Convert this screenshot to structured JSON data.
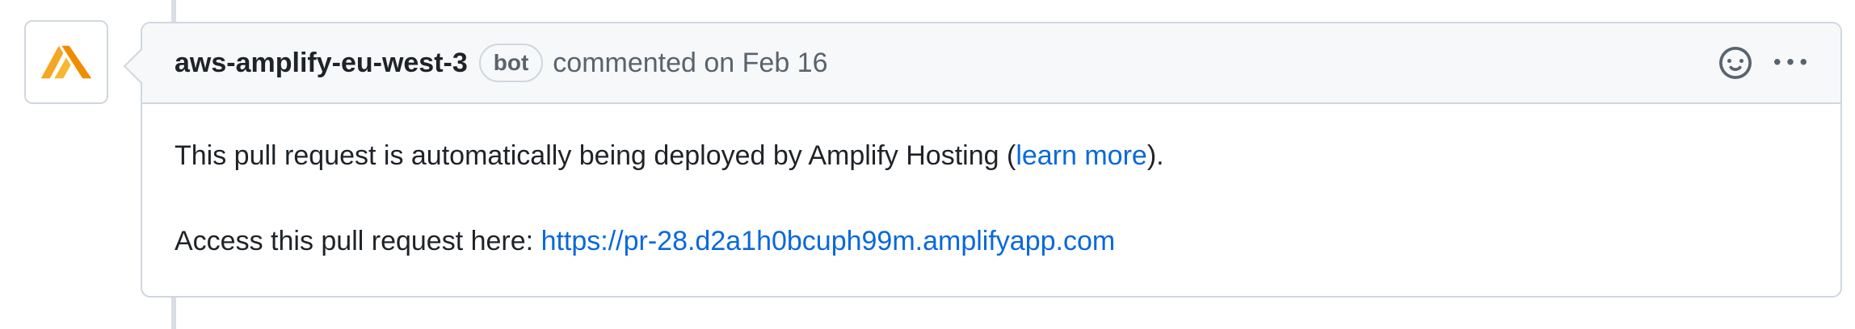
{
  "comment": {
    "author": "aws-amplify-eu-west-3",
    "badge": "bot",
    "meta": "commented on Feb 16",
    "body": {
      "line1_prefix": "This pull request is automatically being deployed by Amplify Hosting (",
      "line1_link": "learn more",
      "line1_suffix": ").",
      "line2_prefix": "Access this pull request here: ",
      "line2_link": "https://pr-28.d2a1h0bcuph99m.amplifyapp.com"
    }
  },
  "icons": {
    "avatar": "aws-amplify-logo",
    "reaction": "smiley-icon",
    "more": "kebab-horizontal-icon"
  },
  "colors": {
    "link": "#0969da",
    "header_bg": "#f6f8fa",
    "border": "#d0d7de",
    "amplify_orange": "#f5a623"
  }
}
